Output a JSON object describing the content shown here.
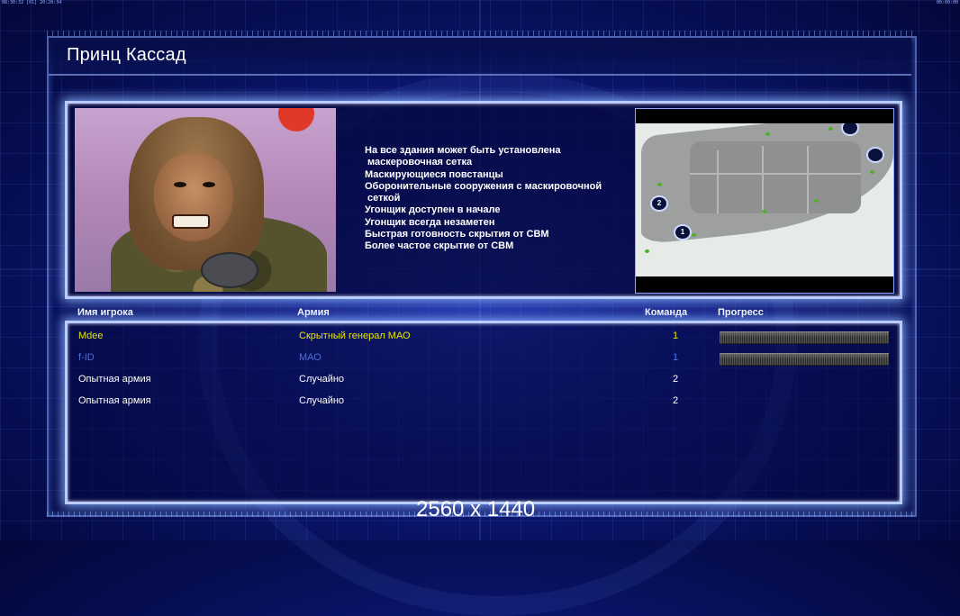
{
  "hud": {
    "left_text": "08:30:32 [01] 20:20:34",
    "right_text": "00:00:00"
  },
  "title": "Принц Кассад",
  "perks": [
    "На все здания может быть установлена",
    " маскеровочная сетка",
    "Маскирующиеся повстанцы",
    "Оборонительные сооружения с маскировочной",
    " сеткой",
    "Угонщик доступен в начале",
    "Угонщик всегда незаметен",
    "Быстрая готовность скрытия от СВМ",
    "Более частое скрытие от СВМ"
  ],
  "minimap": {
    "spawn_1": "1",
    "spawn_2": "2"
  },
  "table": {
    "headers": {
      "player": "Имя игрока",
      "army": "Армия",
      "team": "Команда",
      "progress": "Прогресс"
    },
    "rows": [
      {
        "name": "Mdee",
        "army": "Скрытный генерал МАО",
        "team": "1",
        "color": "#e6e600",
        "progress": 1.0
      },
      {
        "name": "f-ID",
        "army": "МАО",
        "team": "1",
        "color": "#4f6fe0",
        "progress": 1.0
      },
      {
        "name": "Опытная армия",
        "army": "Случайно",
        "team": "2",
        "color": "#ffffff"
      },
      {
        "name": "Опытная армия",
        "army": "Случайно",
        "team": "2",
        "color": "#ffffff"
      }
    ]
  },
  "resolution_text": "2560 x 1440",
  "colors": {
    "accent": "#b8ccff",
    "player_yellow": "#e6e600",
    "player_blue": "#4f6fe0"
  }
}
